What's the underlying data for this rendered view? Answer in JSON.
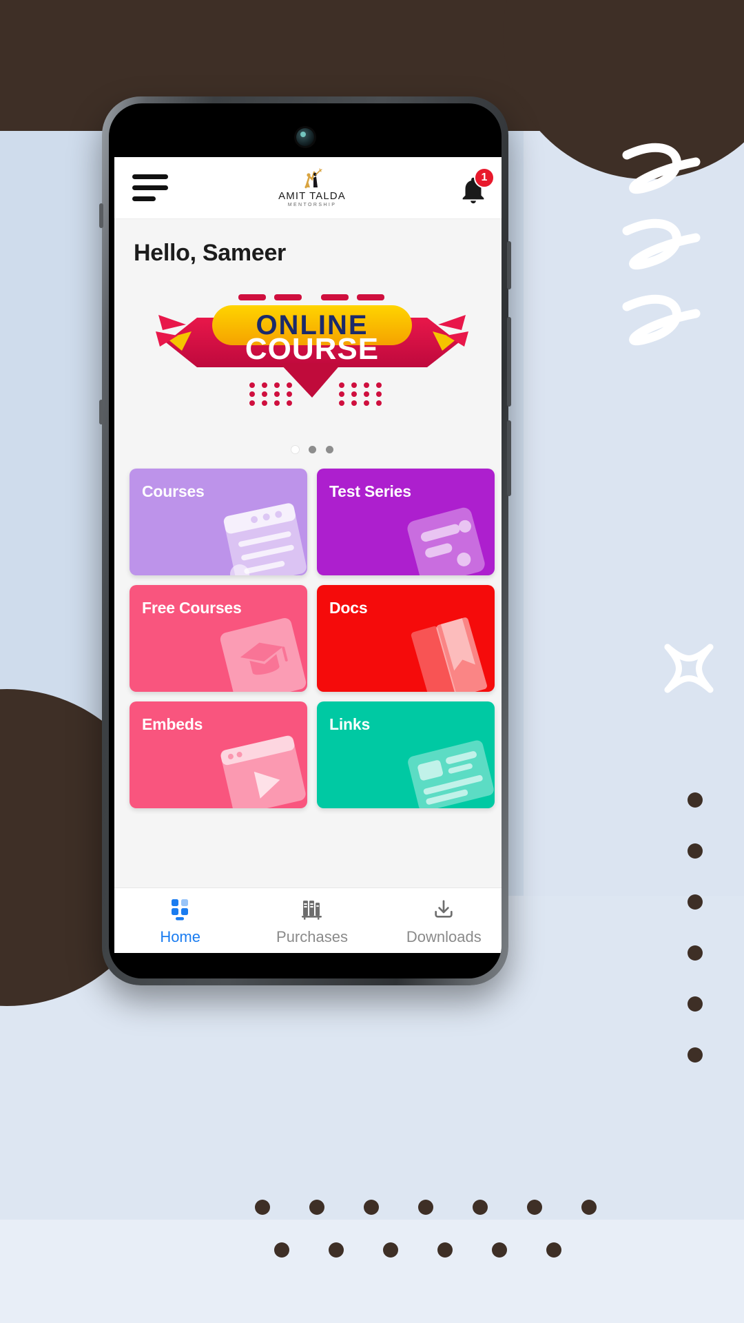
{
  "app": {
    "header": {
      "menu_icon": "hamburger-menu-icon",
      "logo_name": "AMIT TALDA",
      "logo_subtitle": "MENTORSHIP",
      "bell_icon": "notification-bell-icon",
      "notification_count": "1"
    },
    "greeting": "Hello, Sameer",
    "banner": {
      "line1": "ONLINE",
      "line2": "COURSE",
      "dots_total": 3,
      "active_dot_index": 0
    },
    "tiles": [
      {
        "label": "Courses",
        "color": "#bd93ea",
        "art": "document-list-icon"
      },
      {
        "label": "Test Series",
        "color": "#ad1fce",
        "art": "test-papers-icon"
      },
      {
        "label": "Free Courses",
        "color": "#f9557e",
        "art": "graduation-cap-icon"
      },
      {
        "label": "Docs",
        "color": "#f50b0b",
        "art": "book-icon"
      },
      {
        "label": "Embeds",
        "color": "#f9557e",
        "art": "video-player-icon"
      },
      {
        "label": "Links",
        "color": "#00c9a3",
        "art": "link-cards-icon"
      }
    ],
    "bottom_nav": [
      {
        "label": "Home",
        "icon": "grid-dashboard-icon",
        "active": true
      },
      {
        "label": "Purchases",
        "icon": "books-shelf-icon",
        "active": false
      },
      {
        "label": "Downloads",
        "icon": "download-arrow-icon",
        "active": false
      }
    ],
    "colors": {
      "accent": "#1a7cf0",
      "badge": "#e8192c",
      "screen_bg": "#f5f5f5",
      "header_bg": "#ffffff"
    }
  }
}
